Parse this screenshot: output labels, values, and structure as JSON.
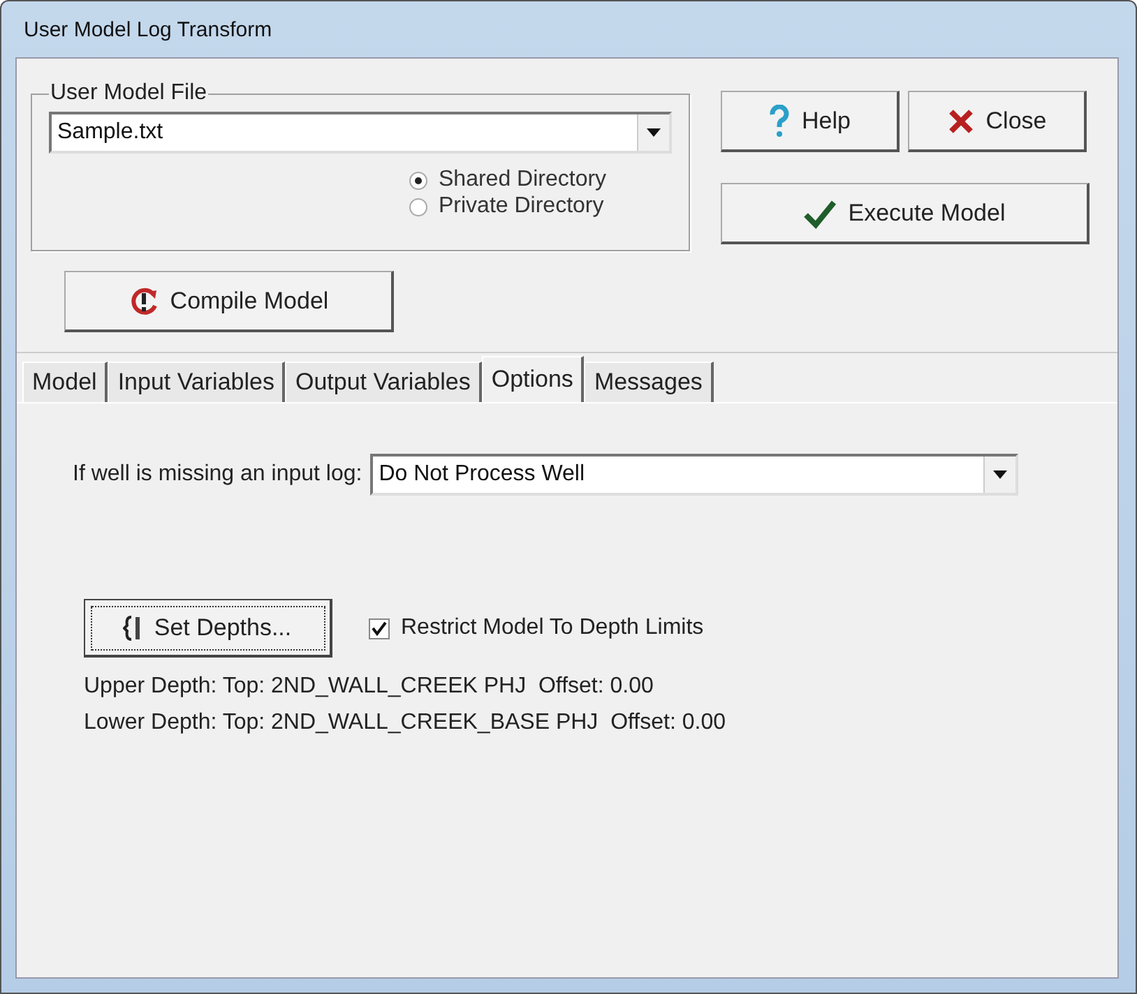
{
  "window": {
    "title": "User Model Log Transform"
  },
  "file_group": {
    "title": "User Model File",
    "file": "Sample.txt",
    "directories": [
      {
        "label": "Shared Directory",
        "selected": true
      },
      {
        "label": "Private Directory",
        "selected": false
      }
    ]
  },
  "buttons": {
    "help": "Help",
    "close": "Close",
    "execute": "Execute Model",
    "compile": "Compile Model"
  },
  "tabs": [
    {
      "label": "Model",
      "selected": false
    },
    {
      "label": "Input Variables",
      "selected": false
    },
    {
      "label": "Output Variables",
      "selected": false
    },
    {
      "label": "Options",
      "selected": true
    },
    {
      "label": "Messages",
      "selected": false
    }
  ],
  "options": {
    "missing_label": "If well is missing an input log:",
    "missing_value": "Do Not Process Well",
    "set_depths": "Set Depths...",
    "restrict": {
      "label": "Restrict Model To Depth Limits",
      "checked": true
    },
    "depth_lines": [
      "Upper Depth: Top: 2ND_WALL_CREEK PHJ  Offset: 0.00",
      "Lower Depth: Top: 2ND_WALL_CREEK_BASE PHJ  Offset: 0.00"
    ]
  }
}
